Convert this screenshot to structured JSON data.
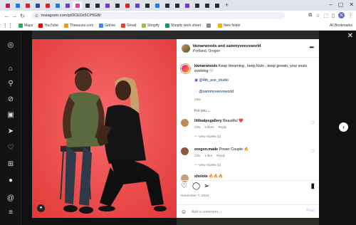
{
  "browser": {
    "tabs": [
      {
        "label": "",
        "color": "#c3165f"
      },
      {
        "label": "",
        "color": "#1a7ae8"
      },
      {
        "label": "",
        "color": "#e02020"
      },
      {
        "label": "",
        "color": "#2a4ba0"
      },
      {
        "label": "",
        "color": "#e02020"
      },
      {
        "label": "",
        "color": "#1a7ae8"
      },
      {
        "label": "",
        "color": "#6b3ad6"
      },
      {
        "label": "",
        "color": "#e53e8b"
      },
      {
        "label": "",
        "color": "#2b2b2b"
      },
      {
        "label": "",
        "color": "#2b2b2b"
      },
      {
        "label": "",
        "color": "#6b3ad6"
      },
      {
        "label": "",
        "color": "#2b2b2b"
      },
      {
        "label": "",
        "color": "#e02020"
      },
      {
        "label": "",
        "color": "#6b3ad6"
      },
      {
        "label": "",
        "color": "#2b2b2b"
      },
      {
        "label": "",
        "color": "#1a7ae8"
      },
      {
        "label": "",
        "color": "#2b2b2b"
      },
      {
        "label": "",
        "color": "#2b2b2b"
      },
      {
        "label": "",
        "color": "#6b3ad6"
      },
      {
        "label": "",
        "color": "#2b2b2b"
      },
      {
        "label": "",
        "color": "#2b2b2b"
      },
      {
        "label": "",
        "color": "#2b2b2b"
      }
    ],
    "active_tab_index": 7,
    "url": "instagram.com/p/DCEDz5CP5GB/",
    "bookmarks": [
      {
        "label": "Maps",
        "color": "#34a853"
      },
      {
        "label": "YouTube",
        "color": "#ff0000"
      },
      {
        "label": "Theeauno.com",
        "color": "#e0a020"
      },
      {
        "label": "Gdrive",
        "color": "#4285f4"
      },
      {
        "label": "Gmail",
        "color": "#ea4335"
      },
      {
        "label": "Shopify",
        "color": "#95bf47"
      },
      {
        "label": "Shopify work sheet",
        "color": "#0f9d58"
      },
      {
        "label": "",
        "color": "#888888"
      },
      {
        "label": "New folder",
        "color": "#f4b400"
      }
    ],
    "all_bookmarks": "All Bookmarks"
  },
  "post": {
    "author": "kkmarwoods and sammyveevsworld",
    "location": "Portland, Oregon",
    "caption_user": "kkmarwoods",
    "caption_text": "Keep dreaming , keep lovin , keep growin, your souls evolving 🤍",
    "mention_1": "@4th_ave_studio",
    "mention_2": "@sammyveevsworld",
    "caption_time": "23w",
    "for_you": "For you ⌄",
    "comments": [
      {
        "user": "littlealpsgallery",
        "text": "Beautiful ❤️",
        "time": "23w",
        "likes": "6 likes",
        "reply": "Reply",
        "replies": "View replies (1)",
        "avatar_color": "#c08a5a"
      },
      {
        "user": "oregon.made",
        "text": "Power Couple 🔥",
        "time": "23w",
        "likes": "1 like",
        "reply": "Reply",
        "replies": "View replies (1)",
        "avatar_color": "#8a5a3a"
      },
      {
        "user": "sholote",
        "text": "🔥🔥🔥",
        "time": "",
        "likes": "",
        "reply": "",
        "replies": "",
        "avatar_color": "#c9a07a"
      }
    ],
    "date": "November 7, 2024",
    "comment_placeholder": "Add a comment…",
    "post_button": "Post"
  }
}
